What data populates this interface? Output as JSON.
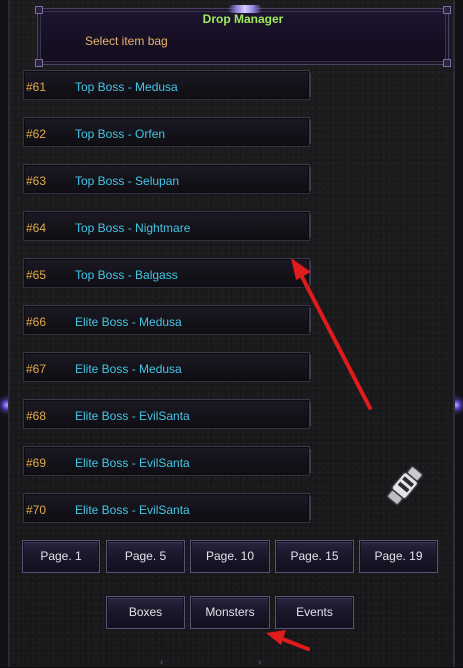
{
  "header": {
    "title": "Drop Manager",
    "subtitle": "Select item bag"
  },
  "items": [
    {
      "num": "#61",
      "name": "Top Boss - Medusa"
    },
    {
      "num": "#62",
      "name": "Top Boss - Orfen"
    },
    {
      "num": "#63",
      "name": "Top Boss - Selupan"
    },
    {
      "num": "#64",
      "name": "Top Boss - Nightmare"
    },
    {
      "num": "#65",
      "name": "Top Boss - Balgass"
    },
    {
      "num": "#66",
      "name": "Elite Boss - Medusa"
    },
    {
      "num": "#67",
      "name": "Elite Boss - Medusa"
    },
    {
      "num": "#68",
      "name": "Elite Boss - EvilSanta"
    },
    {
      "num": "#69",
      "name": "Elite Boss - EvilSanta"
    },
    {
      "num": "#70",
      "name": "Elite Boss - EvilSanta"
    }
  ],
  "pages": [
    "Page. 1",
    "Page. 5",
    "Page. 10",
    "Page. 15",
    "Page. 19"
  ],
  "tabs": [
    "Boxes",
    "Monsters",
    "Events"
  ],
  "colors": {
    "title": "#9fe95c",
    "subtitle": "#e7b56a",
    "item_number": "#e4aa4a",
    "item_name": "#43c6e6",
    "annotation_arrow": "#e01b1b"
  },
  "icons": {
    "cursor": "gauntlet-cursor-icon",
    "annotation": "red-arrow-icon"
  }
}
